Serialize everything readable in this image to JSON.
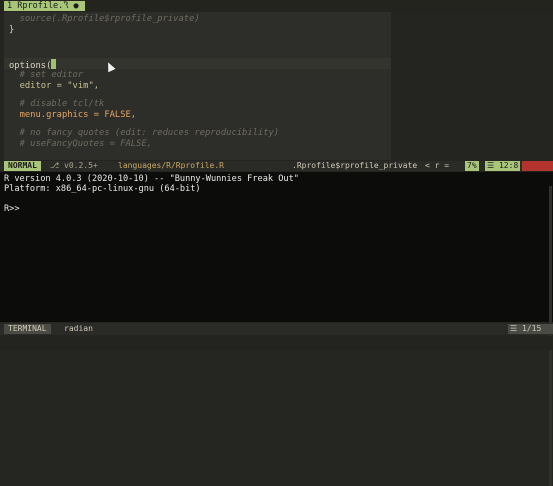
{
  "tabline": {
    "tab_label": "1 Rprofile.R ●"
  },
  "editor": {
    "lines": [
      "  source(.Rprofile$rprofile_private)",
      "}",
      "",
      "",
      "options(",
      "  # set editor",
      "  editor = \"vim\",",
      "",
      "  # disable tcl/tk",
      "  menu.graphics = FALSE,",
      "",
      "  # no fancy quotes (edit: reduces reproducibility)",
      "  # useFancyQuotes = FALSE,"
    ]
  },
  "statusline": {
    "mode": "NORMAL",
    "branch": "⎇ v0.2.5+",
    "file": "languages/R/Rprofile.R",
    "function": ".Rprofile$rprofile_private",
    "filetype": "< r =",
    "percent": "7%",
    "position": "☰ 12:8"
  },
  "terminal": {
    "lines": [
      "R version 4.0.3 (2020-10-10) -- \"Bunny-Wunnies Freak Out\"",
      "Platform: x86_64-pc-linux-gnu (64-bit)",
      "",
      "R>>"
    ]
  },
  "terminal_status": {
    "mode": "TERMINAL",
    "name": "radian",
    "position": "☰ 1/15 ℅"
  },
  "colors": {
    "accent_green": "#a8c57a",
    "warn_red": "#b3332e",
    "terminal_bg": "#0c0c0b",
    "editor_bg": "#2d2d2a"
  }
}
